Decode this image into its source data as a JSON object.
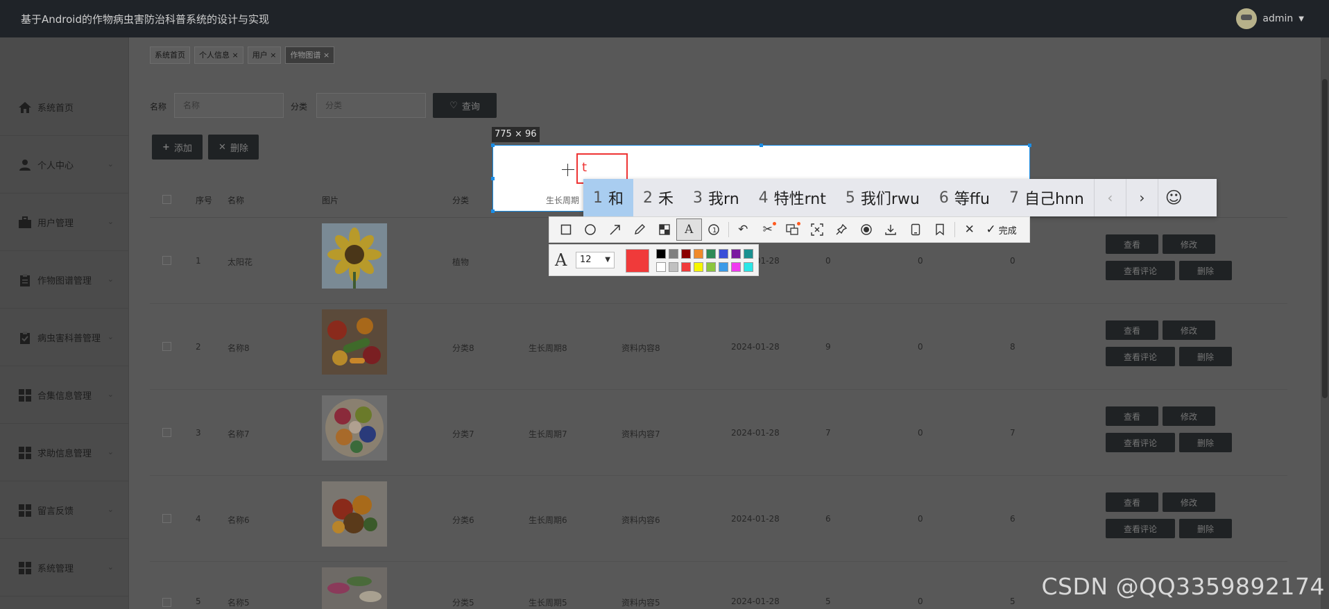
{
  "header": {
    "title": "基于Android的作物病虫害防治科普系统的设计与实现",
    "user": "admin",
    "user_caret": "▼"
  },
  "sidebar": {
    "items": [
      {
        "label": "系统首页",
        "icon": "home-icon",
        "has_chevron": false
      },
      {
        "label": "个人中心",
        "icon": "person-icon",
        "has_chevron": true
      },
      {
        "label": "用户管理",
        "icon": "briefcase-icon",
        "has_chevron": true
      },
      {
        "label": "作物图谱管理",
        "icon": "clipboard-icon",
        "has_chevron": true
      },
      {
        "label": "病虫害科普管理",
        "icon": "checklist-icon",
        "has_chevron": true
      },
      {
        "label": "合集信息管理",
        "icon": "grid-icon",
        "has_chevron": true
      },
      {
        "label": "求助信息管理",
        "icon": "grid-icon",
        "has_chevron": true
      },
      {
        "label": "留言反馈",
        "icon": "grid-icon",
        "has_chevron": true
      },
      {
        "label": "系统管理",
        "icon": "grid-icon",
        "has_chevron": true
      }
    ]
  },
  "tabs": [
    {
      "label": "系统首页",
      "closable": false,
      "active": false
    },
    {
      "label": "个人信息",
      "closable": true,
      "active": false
    },
    {
      "label": "用户",
      "closable": true,
      "active": false
    },
    {
      "label": "作物图谱",
      "closable": true,
      "active": true
    }
  ],
  "search": {
    "name_label": "名称",
    "name_placeholder": "名称",
    "category_label": "分类",
    "category_placeholder": "分类",
    "query_button": "查询"
  },
  "actions": {
    "add_button": "添加",
    "delete_button": "删除"
  },
  "table": {
    "headers": [
      "序号",
      "名称",
      "图片",
      "分类"
    ],
    "rows": [
      {
        "idx": "1",
        "name": "太阳花",
        "image": "sunflower",
        "category": "植物",
        "cycle": "",
        "content": "",
        "date": "2024-01-28",
        "c1": "0",
        "c2": "0",
        "c3": "0"
      },
      {
        "idx": "2",
        "name": "名称8",
        "image": "vegetables",
        "category": "分类8",
        "cycle": "生长周期8",
        "content": "资料内容8",
        "date": "2024-01-28",
        "c1": "9",
        "c2": "0",
        "c3": "8"
      },
      {
        "idx": "3",
        "name": "名称7",
        "image": "fruit-bowl",
        "category": "分类7",
        "cycle": "生长周期7",
        "content": "资料内容7",
        "date": "2024-01-28",
        "c1": "7",
        "c2": "0",
        "c3": "7"
      },
      {
        "idx": "4",
        "name": "名称6",
        "image": "produce",
        "category": "分类6",
        "cycle": "生长周期6",
        "content": "资料内容6",
        "date": "2024-01-28",
        "c1": "6",
        "c2": "0",
        "c3": "6"
      },
      {
        "idx": "5",
        "name": "名称5",
        "image": "radish",
        "category": "分类5",
        "cycle": "生长周期5",
        "content": "资料内容5",
        "date": "2024-01-28",
        "c1": "5",
        "c2": "0",
        "c3": "5"
      }
    ],
    "row_actions": {
      "view": "查看",
      "edit": "修改",
      "view_comments": "查看评论",
      "delete": "删除"
    }
  },
  "overlay": {
    "size_label": "775 × 96",
    "peek_text": "生长周期",
    "typed_text": "t",
    "ime_candidates": [
      {
        "n": "1",
        "text": "和"
      },
      {
        "n": "2",
        "text": "禾"
      },
      {
        "n": "3",
        "text": "我rn"
      },
      {
        "n": "4",
        "text": "特性rnt"
      },
      {
        "n": "5",
        "text": "我们rwu"
      },
      {
        "n": "6",
        "text": "等ffu"
      },
      {
        "n": "7",
        "text": "自己hnn"
      }
    ],
    "ime_prev": "‹",
    "ime_next": "›",
    "ime_emoji": "☺",
    "tools": [
      "rectangle-icon",
      "ellipse-icon",
      "arrow-icon",
      "pencil-icon",
      "mosaic-icon",
      "text-icon",
      "number-icon",
      "undo-icon",
      "scissors-icon",
      "translate-icon",
      "ocr-icon",
      "pin-icon",
      "record-icon",
      "download-icon",
      "phone-icon",
      "bookmark-icon",
      "close-icon",
      "check-icon"
    ],
    "done_label": "完成",
    "font_size": "12",
    "current_color": "#f03a3a",
    "palette": [
      "#000000",
      "#808080",
      "#8b0000",
      "#f08a2a",
      "#2e8b57",
      "#3a4fd8",
      "#7a1aa0",
      "#1a9090",
      "#ffffff",
      "#c0c0c0",
      "#f03a3a",
      "#f6f600",
      "#8cc63f",
      "#3a9ae8",
      "#f03af0",
      "#2ae6e6"
    ]
  },
  "watermark": "CSDN @QQ3359892174"
}
